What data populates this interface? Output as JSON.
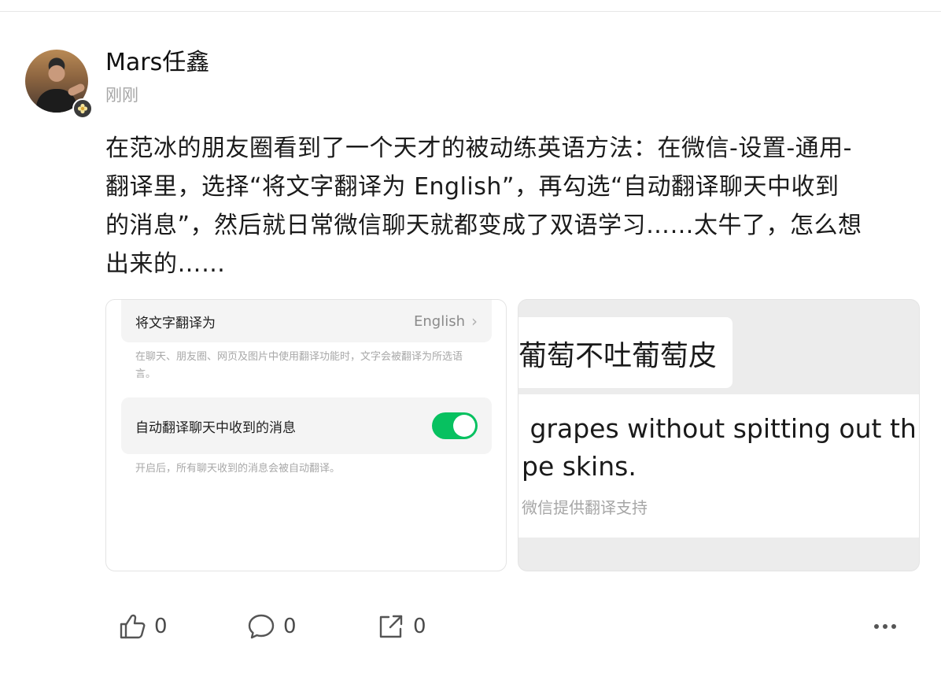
{
  "post": {
    "author": "Mars任鑫",
    "timestamp": "刚刚",
    "text": "在范冰的朋友圈看到了一个天才的被动练英语方法：在微信-设置-通用-\n翻译里，选择“将文字翻译为 English”，再勾选“自动翻译聊天中收到\n的消息”，然后就日常微信聊天就都变成了双语学习……太牛了，怎么想\n出来的……"
  },
  "image_left": {
    "translate_label": "将文字翻译为",
    "translate_value": "English",
    "translate_desc": "在聊天、朋友圈、网页及图片中使用翻译功能时，文字会被翻译为所选语言。",
    "auto_label": "自动翻译聊天中收到的消息",
    "auto_enabled": true,
    "auto_desc": "开启后，所有聊天收到的消息会被自动翻译。",
    "accent_color": "#07c160"
  },
  "image_right": {
    "original_text": "葡萄不吐葡萄皮",
    "translated_text": " grapes without spitting out th\npe skins.",
    "credit": "微信提供翻译支持"
  },
  "actions": {
    "like_count": "0",
    "comment_count": "0",
    "share_count": "0",
    "icons": [
      "thumbs-up-icon",
      "comment-icon",
      "share-icon",
      "more-icon"
    ]
  }
}
